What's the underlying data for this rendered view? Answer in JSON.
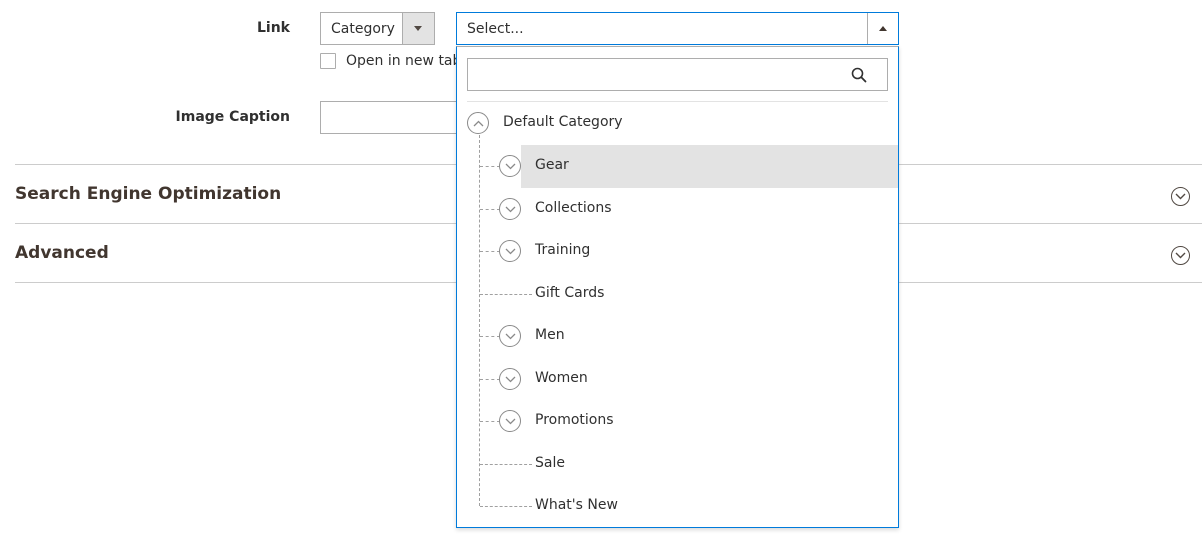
{
  "form": {
    "link_label": "Link",
    "link_type_value": "Category",
    "open_new_tab_label": "Open in new tab",
    "image_caption_label": "Image Caption",
    "image_caption_value": ""
  },
  "sections": [
    {
      "title": "Search Engine Optimization"
    },
    {
      "title": "Advanced"
    }
  ],
  "category_select": {
    "placeholder": "Select...",
    "search_value": "",
    "root": {
      "label": "Default Category",
      "expanded": true
    },
    "children": [
      {
        "label": "Gear",
        "has_children": true,
        "highlighted": true
      },
      {
        "label": "Collections",
        "has_children": true
      },
      {
        "label": "Training",
        "has_children": true
      },
      {
        "label": "Gift Cards",
        "has_children": false
      },
      {
        "label": "Men",
        "has_children": true
      },
      {
        "label": "Women",
        "has_children": true
      },
      {
        "label": "Promotions",
        "has_children": true
      },
      {
        "label": "Sale",
        "has_children": false
      },
      {
        "label": "What's New",
        "has_children": false
      }
    ]
  },
  "colors": {
    "focus_border": "#007bdb",
    "hover_row": "#e3e3e3",
    "text": "#303030"
  }
}
